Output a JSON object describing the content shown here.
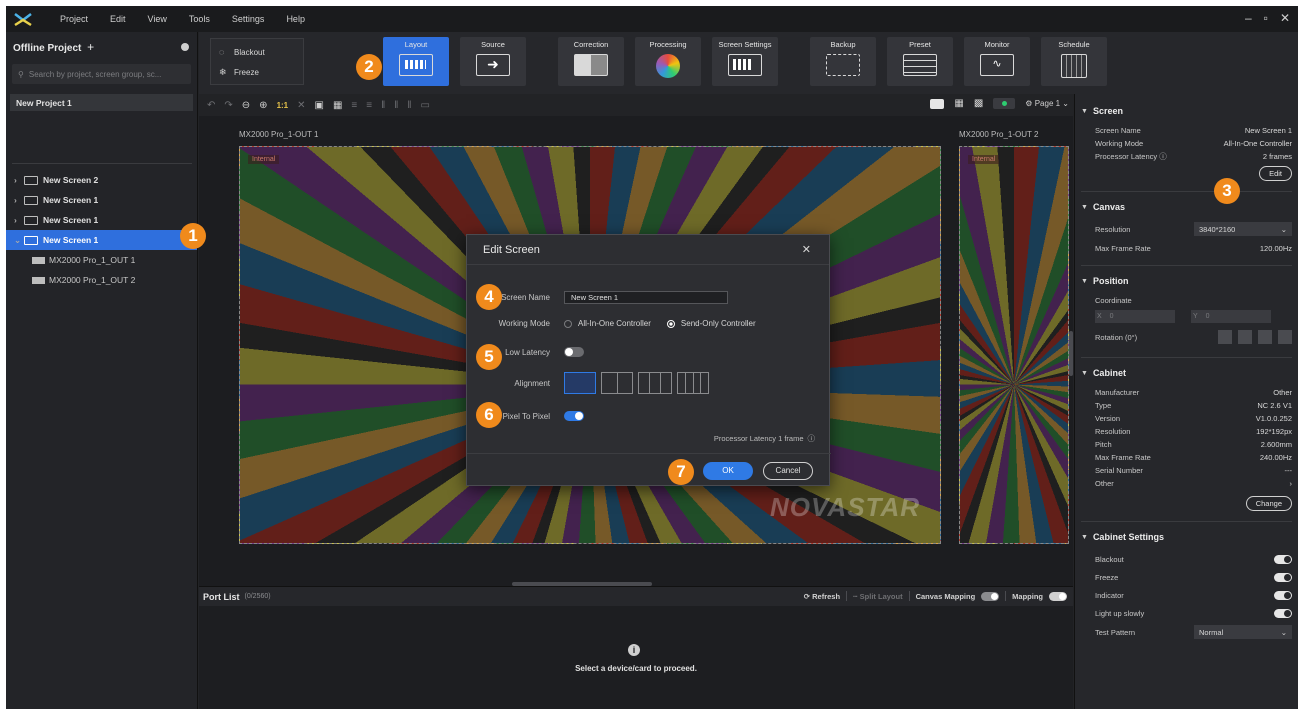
{
  "menubar": {
    "items": [
      "Project",
      "Edit",
      "View",
      "Tools",
      "Settings",
      "Help"
    ],
    "window_controls": [
      "–",
      "▫",
      "✕"
    ]
  },
  "sidebar": {
    "title": "Offline Project",
    "add_label": "+",
    "search_placeholder": "Search by project, screen group, sc...",
    "project_item": "New Project 1",
    "tree": [
      {
        "label": "New Screen 2",
        "chevron": "›",
        "selected": false
      },
      {
        "label": "New Screen 1",
        "chevron": "›",
        "selected": false
      },
      {
        "label": "New Screen 1",
        "chevron": "›",
        "selected": false
      },
      {
        "label": "New Screen 1",
        "chevron": "⌄",
        "selected": true
      }
    ],
    "sub_items": [
      "MX2000 Pro_1_OUT 1",
      "MX2000 Pro_1_OUT 2"
    ]
  },
  "ribbon": {
    "blackout_label": "Blackout",
    "freeze_label": "Freeze",
    "tools": [
      {
        "label": "Layout",
        "active": true
      },
      {
        "label": "Source",
        "active": false
      },
      {
        "label": "Correction",
        "active": false
      },
      {
        "label": "Processing",
        "active": false
      },
      {
        "label": "Screen Settings",
        "active": false
      },
      {
        "label": "Backup",
        "active": false
      },
      {
        "label": "Preset",
        "active": false
      },
      {
        "label": "Monitor",
        "active": false
      },
      {
        "label": "Schedule",
        "active": false
      }
    ]
  },
  "canvas_toolbar": {
    "ratio_label": "1:1",
    "page_label": "Page 1"
  },
  "canvas": {
    "out1_label": "MX2000 Pro_1-OUT 1",
    "out2_label": "MX2000 Pro_1-OUT 2",
    "internal_tag": "Internal",
    "watermark": "NOVASTAR"
  },
  "portlist": {
    "title": "Port List",
    "count": "(0/2560)",
    "refresh_label": "Refresh",
    "split_layout_label": "Split Layout",
    "canvas_mapping_label": "Canvas Mapping",
    "mapping_label": "Mapping",
    "empty_message": "Select a device/card to proceed."
  },
  "right_panel": {
    "screen": {
      "title": "Screen",
      "rows": [
        {
          "label": "Screen Name",
          "value": "New Screen 1"
        },
        {
          "label": "Working Mode",
          "value": "All-In-One Controller"
        },
        {
          "label": "Processor Latency",
          "value": "2 frames"
        }
      ],
      "edit_label": "Edit"
    },
    "canvas": {
      "title": "Canvas",
      "resolution_label": "Resolution",
      "resolution_value": "3840*2160",
      "max_frame_label": "Max Frame Rate",
      "max_frame_value": "120.00Hz"
    },
    "position": {
      "title": "Position",
      "coordinate_label": "Coordinate",
      "x_label": "X",
      "y_label": "Y",
      "x_value": "0",
      "y_value": "0",
      "rotation_label": "Rotation (0°)"
    },
    "cabinet": {
      "title": "Cabinet",
      "rows": [
        {
          "label": "Manufacturer",
          "value": "Other"
        },
        {
          "label": "Type",
          "value": "NC 2.6 V1"
        },
        {
          "label": "Version",
          "value": "V1.0.0.252"
        },
        {
          "label": "Resolution",
          "value": "192*192px"
        },
        {
          "label": "Pitch",
          "value": "2.600mm"
        },
        {
          "label": "Max Frame Rate",
          "value": "240.00Hz"
        },
        {
          "label": "Serial Number",
          "value": "---"
        },
        {
          "label": "Other",
          "value": "›"
        }
      ],
      "change_label": "Change"
    },
    "cabinet_settings": {
      "title": "Cabinet Settings",
      "toggles": [
        "Blackout",
        "Freeze",
        "Indicator",
        "Light up slowly"
      ],
      "test_pattern_label": "Test Pattern",
      "test_pattern_value": "Normal"
    }
  },
  "modal": {
    "title": "Edit Screen",
    "screen_name_label": "Screen Name",
    "screen_name_value": "New Screen 1",
    "working_mode_label": "Working Mode",
    "mode_option_1": "All-In-One Controller",
    "mode_option_2": "Send-Only Controller",
    "low_latency_label": "Low Latency",
    "low_latency_on": false,
    "alignment_label": "Alignment",
    "pixel_to_pixel_label": "Pixel To Pixel",
    "pixel_to_pixel_on": true,
    "processor_latency_text": "Processor Latency 1 frame",
    "ok_label": "OK",
    "cancel_label": "Cancel"
  },
  "callouts": [
    "1",
    "2",
    "3",
    "4",
    "5",
    "6",
    "7"
  ],
  "colors": {
    "accent": "#2f7ae5",
    "callout": "#f08a1c",
    "background": "#222326"
  }
}
